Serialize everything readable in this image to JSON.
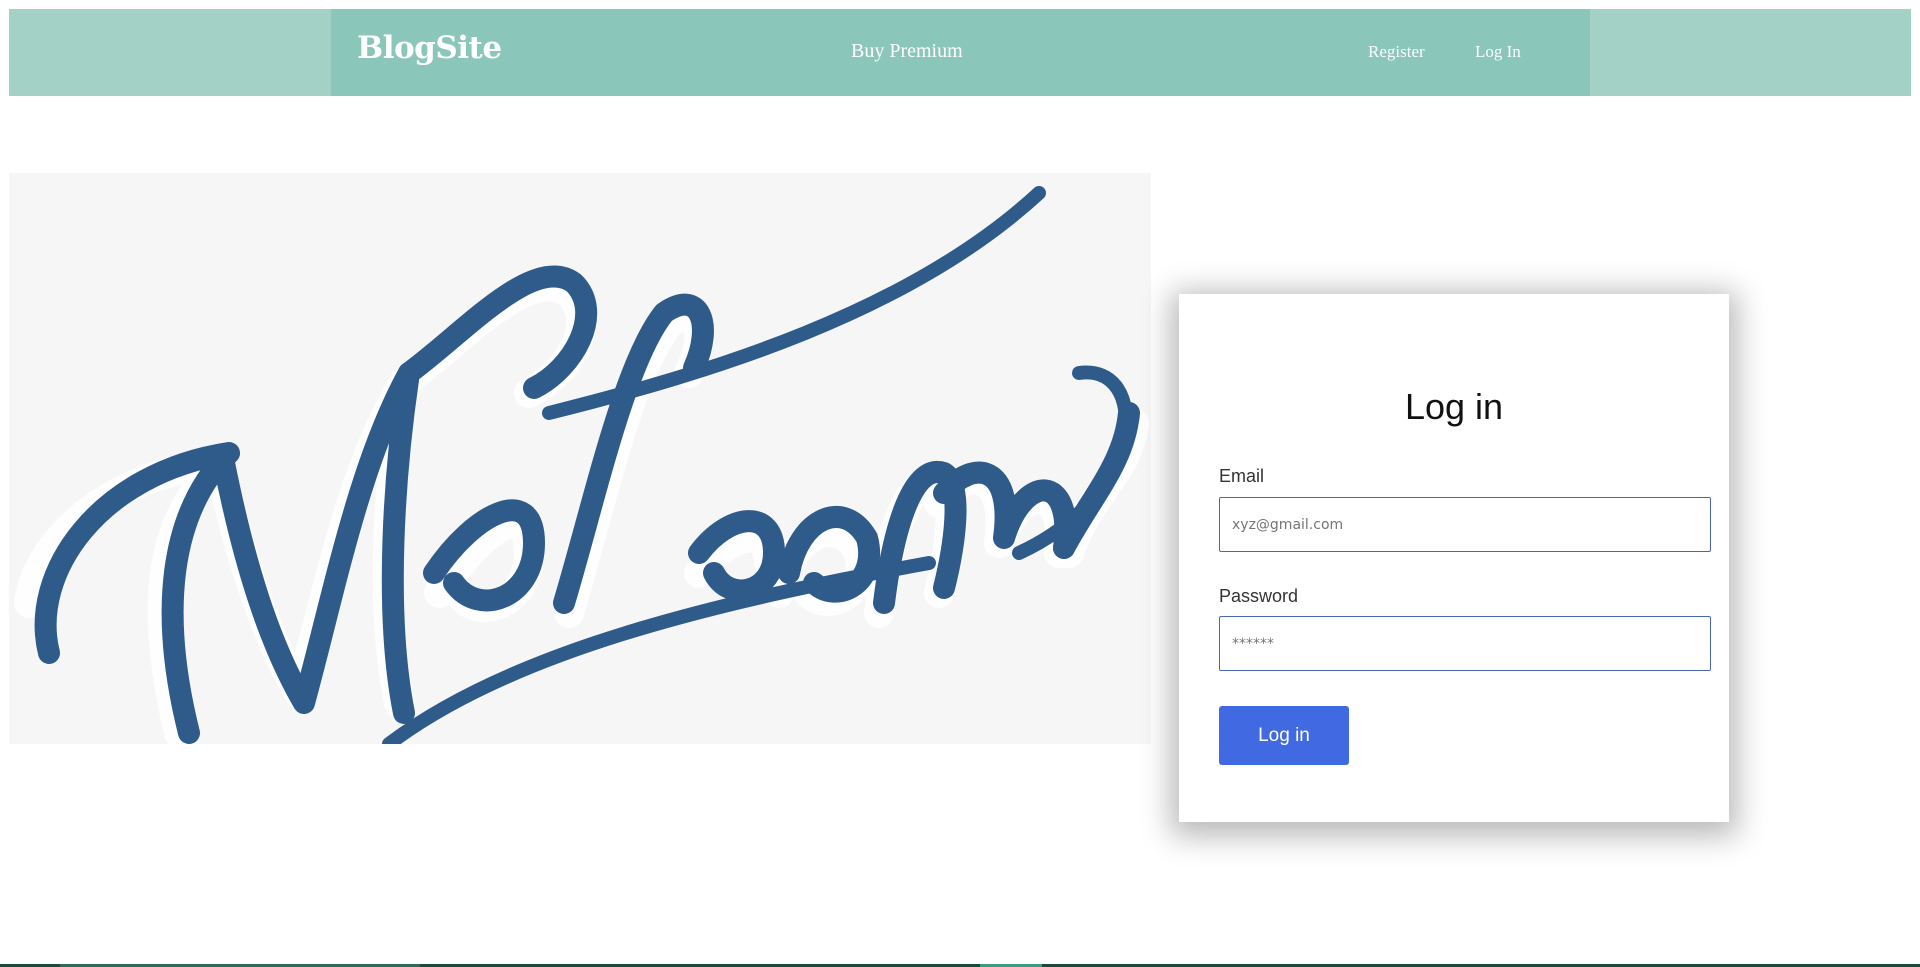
{
  "navbar": {
    "brand": "BlogSite",
    "premium_link": "Buy Premium",
    "register_link": "Register",
    "login_link": "Log In",
    "colors": {
      "outer": "#a3d1c5",
      "inner": "#8bc6ba",
      "text": "#ffffff"
    }
  },
  "hero": {
    "image_text": "Welcome",
    "colors": {
      "background": "#f6f6f7",
      "script": "#2f5b8a"
    }
  },
  "login_card": {
    "title": "Log in",
    "email_label": "Email",
    "email_placeholder": "xyz@gmail.com",
    "password_label": "Password",
    "password_placeholder": "******",
    "submit_label": "Log in",
    "colors": {
      "button": "#4169e1",
      "input_border": "#4a67b5"
    }
  }
}
